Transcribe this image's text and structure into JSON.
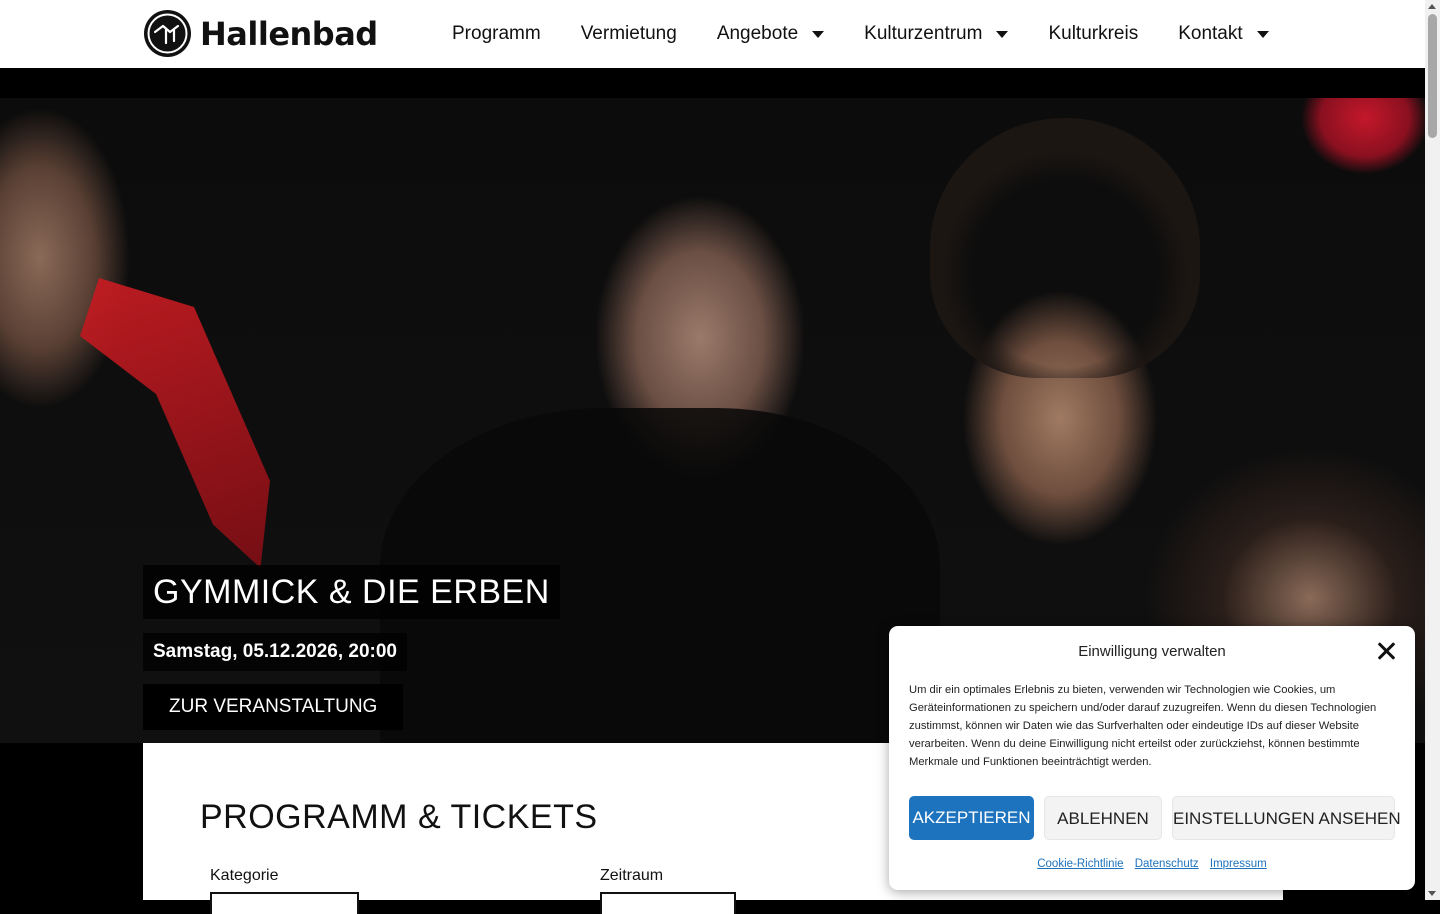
{
  "header": {
    "logo_text": "Hallenbad",
    "nav": [
      {
        "label": "Programm",
        "has_dropdown": false
      },
      {
        "label": "Vermietung",
        "has_dropdown": false
      },
      {
        "label": "Angebote",
        "has_dropdown": true
      },
      {
        "label": "Kulturzentrum",
        "has_dropdown": true
      },
      {
        "label": "Kulturkreis",
        "has_dropdown": false
      },
      {
        "label": "Kontakt",
        "has_dropdown": true
      }
    ]
  },
  "hero": {
    "title": "GYMMICK & DIE ERBEN",
    "date": "Samstag, 05.12.2026, 20:00",
    "button_label": "ZUR VERANSTALTUNG"
  },
  "content": {
    "section_title": "PROGRAMM & TICKETS",
    "filters": [
      {
        "label": "Kategorie"
      },
      {
        "label": "Zeitraum"
      }
    ]
  },
  "cookie_modal": {
    "title": "Einwilligung verwalten",
    "text": "Um dir ein optimales Erlebnis zu bieten, verwenden wir Technologien wie Cookies, um Geräteinformationen zu speichern und/oder darauf zuzugreifen. Wenn du diesen Technologien zustimmst, können wir Daten wie das Surfverhalten oder eindeutige IDs auf dieser Website verarbeiten. Wenn du deine Einwilligung nicht erteilst oder zurückziehst, können bestimmte Merkmale und Funktionen beeinträchtigt werden.",
    "accept_label": "AKZEPTIEREN",
    "deny_label": "ABLEHNEN",
    "settings_label": "EINSTELLUNGEN ANSEHEN",
    "links": [
      "Cookie-Richtlinie",
      "Datenschutz",
      "Impressum"
    ],
    "accent_color": "#1e73be"
  },
  "icons": {
    "logo": "hallenbad-logo-icon",
    "dropdown": "caret-down-icon",
    "close": "close-icon"
  }
}
